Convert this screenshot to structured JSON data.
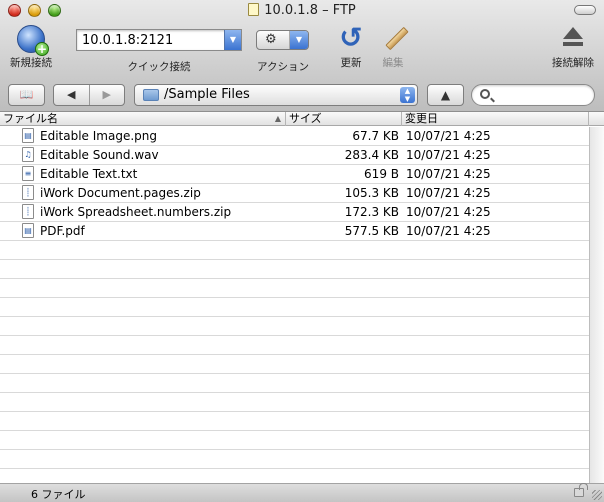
{
  "window": {
    "title": "10.0.1.8 – FTP"
  },
  "toolbar": {
    "new_connection": "新規接続",
    "quick_connect_value": "10.0.1.8:2121",
    "quick_connect_label": "クイック接続",
    "action_label": "アクション",
    "refresh_label": "更新",
    "edit_label": "編集",
    "disconnect_label": "接続解除"
  },
  "pathbar": {
    "back_glyph": "◀",
    "forward_glyph": "▶",
    "path": "/Sample Files",
    "up_glyph": "▲",
    "search_value": ""
  },
  "columns": {
    "name": "ファイル名",
    "size": "サイズ",
    "modified": "変更日"
  },
  "files": [
    {
      "name": "Editable Image.png",
      "size": "67.7 KB",
      "modified": "10/07/21 4:25",
      "icon": "image-file-icon",
      "glyph": "▤"
    },
    {
      "name": "Editable Sound.wav",
      "size": "283.4 KB",
      "modified": "10/07/21 4:25",
      "icon": "audio-file-icon",
      "glyph": "♫"
    },
    {
      "name": "Editable Text.txt",
      "size": "619 B",
      "modified": "10/07/21 4:25",
      "icon": "text-file-icon",
      "glyph": "≡"
    },
    {
      "name": "iWork Document.pages.zip",
      "size": "105.3 KB",
      "modified": "10/07/21 4:25",
      "icon": "zip-file-icon",
      "glyph": "┊"
    },
    {
      "name": "iWork Spreadsheet.numbers.zip",
      "size": "172.3 KB",
      "modified": "10/07/21 4:25",
      "icon": "zip-file-icon",
      "glyph": "┊"
    },
    {
      "name": "PDF.pdf",
      "size": "577.5 KB",
      "modified": "10/07/21 4:25",
      "icon": "pdf-file-icon",
      "glyph": "▤"
    }
  ],
  "status": {
    "item_count": "6 ファイル"
  }
}
